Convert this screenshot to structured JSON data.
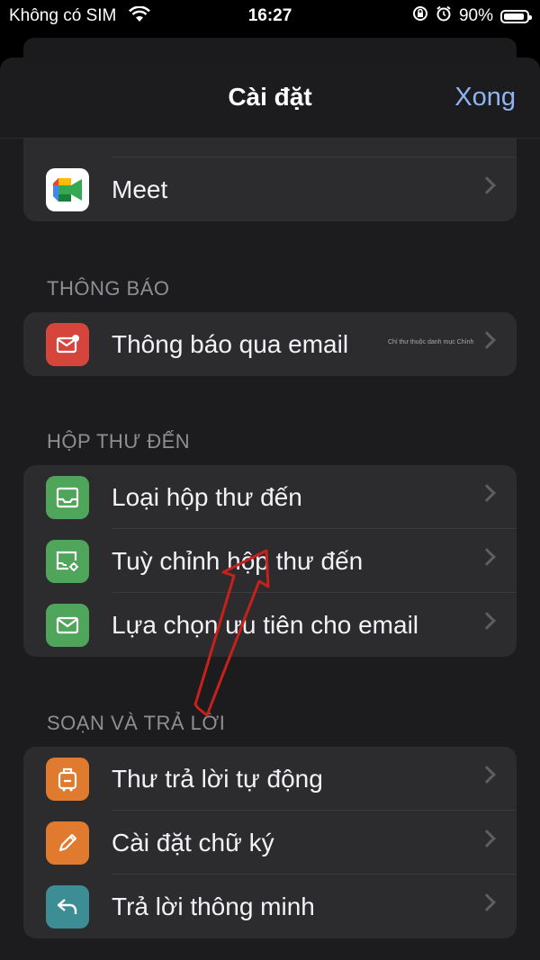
{
  "status_bar": {
    "carrier": "Không có SIM",
    "time": "16:27",
    "battery": "90%"
  },
  "nav": {
    "title": "Cài đặt",
    "done": "Xong"
  },
  "sections": {
    "top": {
      "items": [
        {
          "label": "Meet",
          "icon": "meet-icon"
        }
      ]
    },
    "notifications": {
      "header": "THÔNG BÁO",
      "items": [
        {
          "label": "Thông báo qua email",
          "icon": "mail-alert-icon",
          "note": "Chỉ thư thuộc danh mục Chính"
        }
      ]
    },
    "inbox": {
      "header": "HỘP THƯ ĐẾN",
      "items": [
        {
          "label": "Loại hộp thư đến",
          "icon": "inbox-icon"
        },
        {
          "label": "Tuỳ chỉnh hộp thư đến",
          "icon": "inbox-settings-icon"
        },
        {
          "label": "Lựa chọn ưu tiên cho email",
          "icon": "envelope-icon"
        }
      ]
    },
    "compose": {
      "header": "SOẠN VÀ TRẢ LỜI",
      "items": [
        {
          "label": "Thư trả lời tự động",
          "icon": "suitcase-icon"
        },
        {
          "label": "Cài đặt chữ ký",
          "icon": "pen-icon"
        },
        {
          "label": "Trả lời thông minh",
          "icon": "reply-icon"
        }
      ]
    }
  },
  "colors": {
    "green": "#4fa55a",
    "red": "#d6453c",
    "orange": "#e07a2e",
    "teal": "#3d8d94",
    "accent": "#8fb4f4"
  }
}
